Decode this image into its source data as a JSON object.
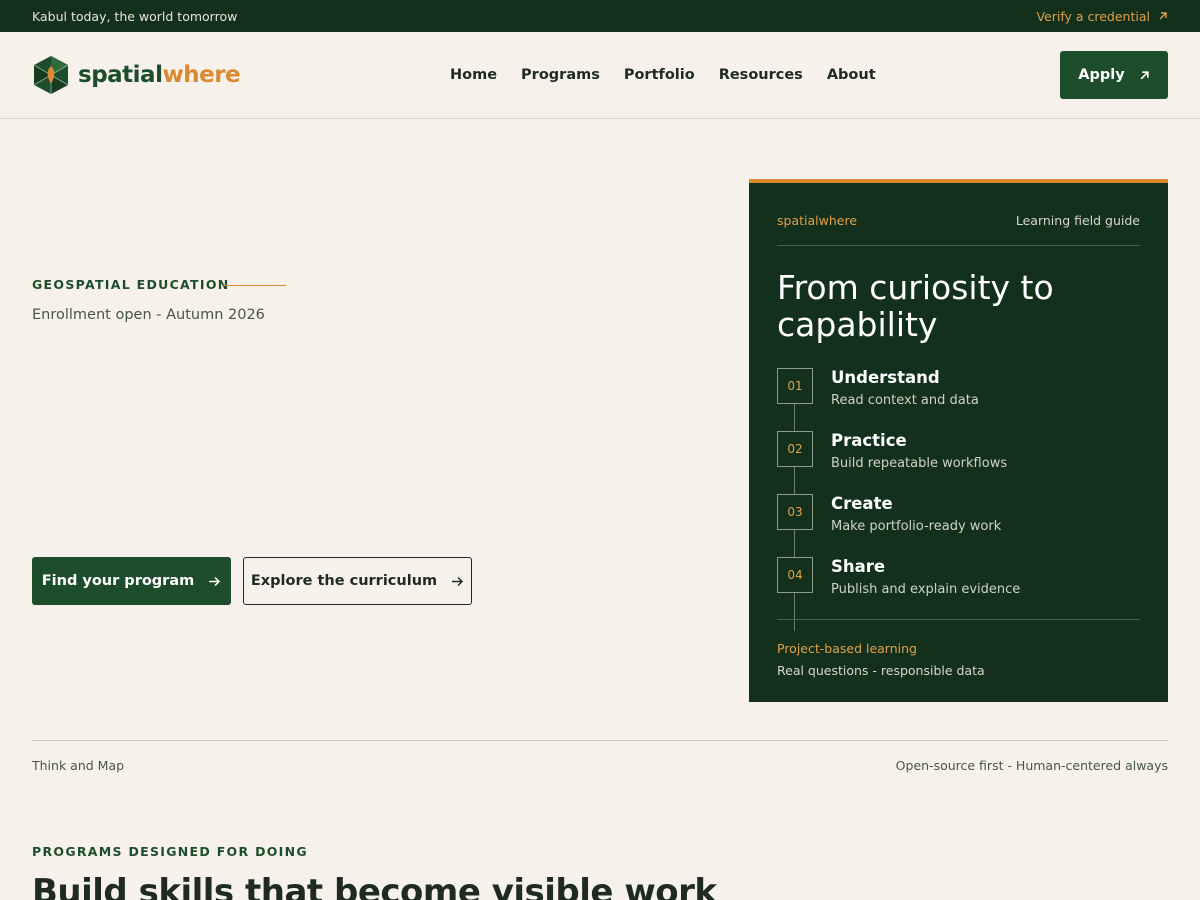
{
  "topbar": {
    "tagline": "Kabul today, the world tomorrow",
    "verify_label": "Verify a credential",
    "verify_icon": "arrow-up-right-icon"
  },
  "brand": {
    "part1": "spatial",
    "part2": "where",
    "logo_icon": "hexagon-globe-logo"
  },
  "nav": {
    "items": [
      {
        "label": "Home"
      },
      {
        "label": "Programs"
      },
      {
        "label": "Portfolio"
      },
      {
        "label": "Resources"
      },
      {
        "label": "About"
      }
    ],
    "apply_label": "Apply"
  },
  "hero": {
    "eyebrow": "GEOSPATIAL EDUCATION",
    "enrollment": "Enrollment open - Autumn 2026",
    "primary_cta": "Find your program",
    "secondary_cta": "Explore the curriculum"
  },
  "card": {
    "brand": "spatialwhere",
    "guide_label": "Learning field guide",
    "title": "From curiosity to capability",
    "steps": [
      {
        "num": "01",
        "title": "Understand",
        "desc": "Read context and data"
      },
      {
        "num": "02",
        "title": "Practice",
        "desc": "Build repeatable workflows"
      },
      {
        "num": "03",
        "title": "Create",
        "desc": "Make portfolio-ready work"
      },
      {
        "num": "04",
        "title": "Share",
        "desc": "Publish and explain evidence"
      }
    ],
    "footer_highlight": "Project-based learning",
    "footer_text": "Real questions - responsible data"
  },
  "band": {
    "left": "Think and Map",
    "right": "Open-source first - Human-centered always"
  },
  "programs": {
    "eyebrow": "PROGRAMS DESIGNED FOR DOING",
    "title": "Build skills that become visible work"
  },
  "colors": {
    "dark_green": "#13301c",
    "brand_green": "#1e4d2b",
    "accent_orange": "#d98a33",
    "background": "#f6f2eb"
  }
}
